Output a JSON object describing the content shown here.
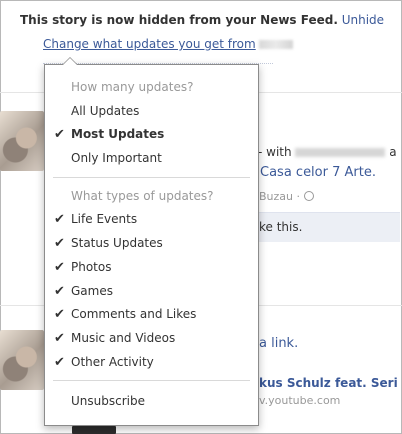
{
  "hidden_notice": {
    "message": "This story is now hidden from your News Feed.",
    "unhide_label": "Unhide",
    "change_updates_label": "Change what updates you get from"
  },
  "menu": {
    "how_many_title": "How many updates?",
    "how_many_items": [
      {
        "label": "All Updates",
        "checked": false
      },
      {
        "label": "Most Updates",
        "checked": true
      },
      {
        "label": "Only Important",
        "checked": false
      }
    ],
    "types_title": "What types of updates?",
    "types_items": [
      {
        "label": "Life Events",
        "checked": true
      },
      {
        "label": "Status Updates",
        "checked": true
      },
      {
        "label": "Photos",
        "checked": true
      },
      {
        "label": "Games",
        "checked": true
      },
      {
        "label": "Comments and Likes",
        "checked": true
      },
      {
        "label": "Music and Videos",
        "checked": true
      },
      {
        "label": "Other Activity",
        "checked": true
      }
    ],
    "unsubscribe_label": "Unsubscribe",
    "check_glyph": "✔"
  },
  "background": {
    "story1_with": "with",
    "story1_suffix": "a",
    "story1_title": "Casa celor 7 Arte.",
    "story1_location": "Buzau ·",
    "story1_like": "ke this.",
    "story2_link": "a link.",
    "story2_title": "kus Schulz feat. Seri -",
    "story2_source": "v.youtube.com"
  },
  "colors": {
    "link": "#3b5998",
    "muted": "#999999",
    "text": "#333333"
  }
}
